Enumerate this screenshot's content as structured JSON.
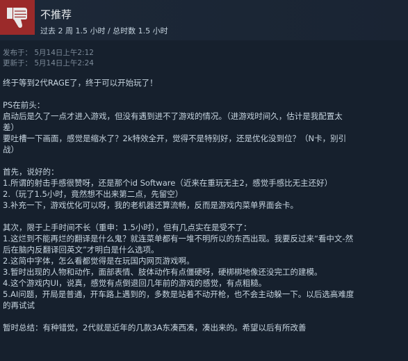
{
  "colors": {
    "page_bg": "#16202d",
    "header_bg": "#1b2635",
    "thumb_bg": "#9b2a2a",
    "text": "#c6d4df",
    "muted": "#7c8a99"
  },
  "header": {
    "icon": "thumbs-down-icon",
    "verdict": "不推荐",
    "hours": "过去 2 周 1.5 小时 / 总时数 1.5 小时"
  },
  "dates": {
    "posted": "发布于：  5月14日上午2:12",
    "updated": "更新于：  5月14日上午2:24"
  },
  "review": {
    "lines": [
      "终于等到2代RAGE了，终于可以开始玩了！",
      "",
      "PS在前头：",
      "启动后是久了一点才进入游戏，但没有遇到进不了游戏的情况。（进游戏时间久，估计是我配置太",
      "差）",
      "要吐槽一下画面，感觉是缩水了？2k特效全开，觉得不是特别好，还是优化没到位？（N卡，别引",
      "战）",
      "",
      "首先，说好的：",
      "1.所谓的射击手感很赞呀，还是那个id Software（近来在重玩无主2，感觉手感比无主还好）",
      "2.（玩了1.5小时，竟然想不出来第二点，先留空）",
      "3.补充一下，游戏优化可以呀，我的老机器还算流畅，反而是游戏内菜单界面会卡。",
      "",
      "其次，限于上手时间不长（重申：1.5小时），但有几点实在是受不了：",
      "1.这烂到不能再烂的翻译是什么鬼？就连菜单都有一堆不明所以的东西出现。我要反过来“看中文-然",
      "后在脑内反翻译回英文”才明白是什么选项。",
      "2.这简中字体，怎么看都觉得是在玩国内网页游戏啊。",
      "3.暂时出现的人物和动作，面部表情、肢体动作有点僵硬呀，硬梆梆地像还没完工的建模。",
      "4.这个游戏内UI，说真，感觉有点倒退回几年前的游戏的感觉，有点粗糙。",
      "5.AI问题，开局是普通，开车路上遇到的，多数是站着不动开枪，也不会主动躲一下。以后选高难度",
      "的再试试",
      "",
      "暂时总结：有种错觉，2代就是近年的几款3A东凑西凑，凑出来的。希望以后有所改善"
    ]
  }
}
